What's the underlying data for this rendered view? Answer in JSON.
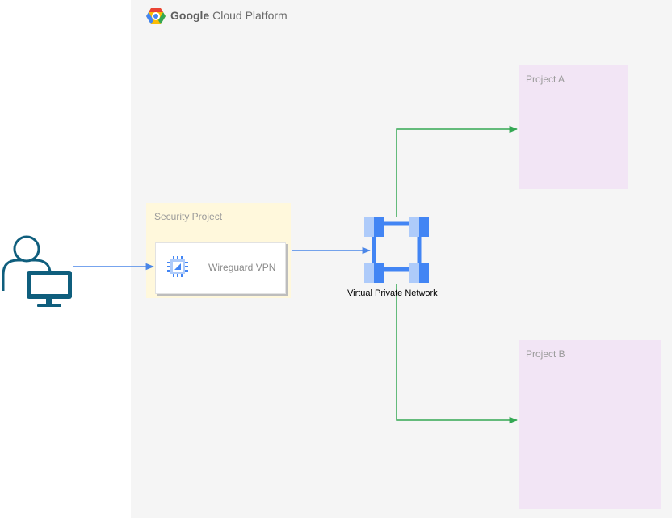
{
  "header": {
    "brand_bold": "Google",
    "brand_rest": "Cloud Platform"
  },
  "security_project": {
    "label": "Security Project",
    "vpn_label": "Wireguard VPN"
  },
  "network": {
    "label": "Virtual Private Network"
  },
  "projects": [
    {
      "label": "Project A"
    },
    {
      "label": "Project B"
    }
  ],
  "icons": {
    "user": "user-computer-icon",
    "gcp": "google-cloud-icon",
    "vpn": "compute-engine-icon",
    "network": "vpc-network-icon"
  },
  "colors": {
    "panel": "#f5f5f5",
    "security_fill": "#fff8dc",
    "project_fill": "#f2e5f5",
    "user_icon": "#0f5e7d",
    "blue_edge": "#4a86e8",
    "green_edge": "#34a853",
    "network_light": "#aecbfa",
    "network_dark": "#4285f4"
  }
}
